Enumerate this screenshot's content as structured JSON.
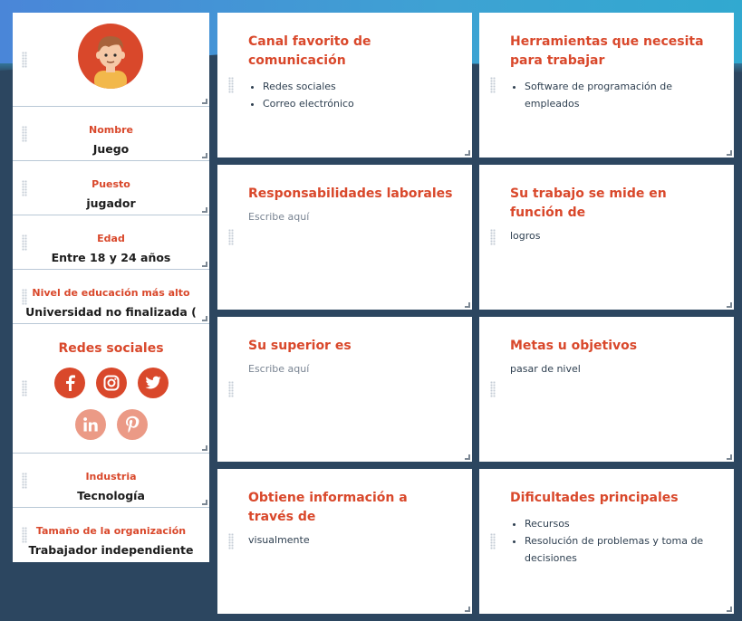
{
  "sidebar": {
    "fields": [
      {
        "label": "Nombre",
        "value": "Juego"
      },
      {
        "label": "Puesto",
        "value": "jugador"
      },
      {
        "label": "Edad",
        "value": "Entre 18 y 24 años"
      },
      {
        "label": "Nivel de educación más alto",
        "value": "Universidad no finalizada ("
      }
    ],
    "social_title": "Redes sociales",
    "social_icons": [
      "facebook-icon",
      "instagram-icon",
      "twitter-icon",
      "linkedin-icon",
      "pinterest-icon"
    ],
    "fields2": [
      {
        "label": "Industria",
        "value": "Tecnología"
      },
      {
        "label": "Tamaño de la organización",
        "value": "Trabajador independiente"
      }
    ]
  },
  "cards": [
    {
      "title": "Canal favorito de comunicación",
      "items": [
        "Redes sociales",
        "Correo electrónico"
      ]
    },
    {
      "title": "Herramientas que necesita para trabajar",
      "items": [
        "Software de programación de empleados"
      ]
    },
    {
      "title": "Responsabilidades laborales",
      "text": "Escribe aquí"
    },
    {
      "title": "Su trabajo se mide en función de",
      "text": "logros"
    },
    {
      "title": "Su superior es",
      "text": "Escribe aquí"
    },
    {
      "title": "Metas u objetivos",
      "text": "pasar de nivel"
    },
    {
      "title": "Obtiene información a través de",
      "text": "visualmente"
    },
    {
      "title": "Dificultades principales",
      "items": [
        "Recursos",
        "Resolución de problemas y toma de decisiones"
      ]
    }
  ],
  "colors": {
    "accent": "#d9482b",
    "accent_light": "#eb9a86",
    "background": "#2c4660"
  }
}
